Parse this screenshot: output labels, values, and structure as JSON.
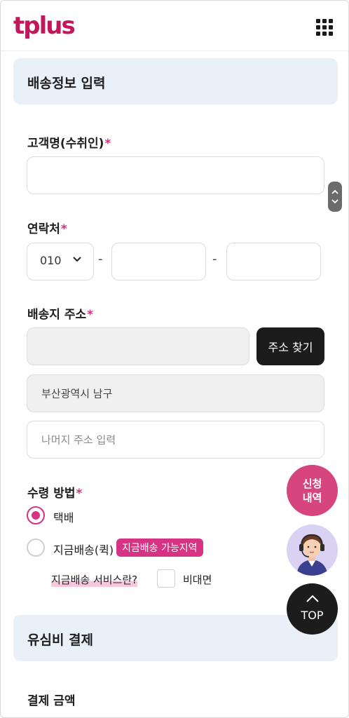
{
  "header": {
    "logo_text": "tplus",
    "menu_icon": "grid-menu-icon"
  },
  "shipping_section": {
    "title": "배송정보 입력"
  },
  "fields": {
    "name_label": "고객명(수취인)",
    "required_mark": "*",
    "phone_label": "연락처",
    "phone_prefix": "010",
    "phone_dash": "-",
    "address_label": "배송지 주소",
    "address_search_button": "주소 찾기",
    "address_region": "부산광역시 남구",
    "address_detail_placeholder": "나머지 주소 입력",
    "receive_label": "수령 방법"
  },
  "receive_options": {
    "option1": "택배",
    "option2": "지금배송(퀵)",
    "badge": "지금배송 가능지역",
    "info_link": "지금배송 서비스란?",
    "contactless": "비대면"
  },
  "payment_section": {
    "title": "유심비 결제",
    "amount_label": "결제 금액"
  },
  "floating": {
    "history_line1": "신청",
    "history_line2": "내역",
    "top_label": "TOP"
  },
  "colors": {
    "accent": "#d63384",
    "section_bg": "#e9f0f8",
    "dark_button": "#1c1c1c"
  }
}
